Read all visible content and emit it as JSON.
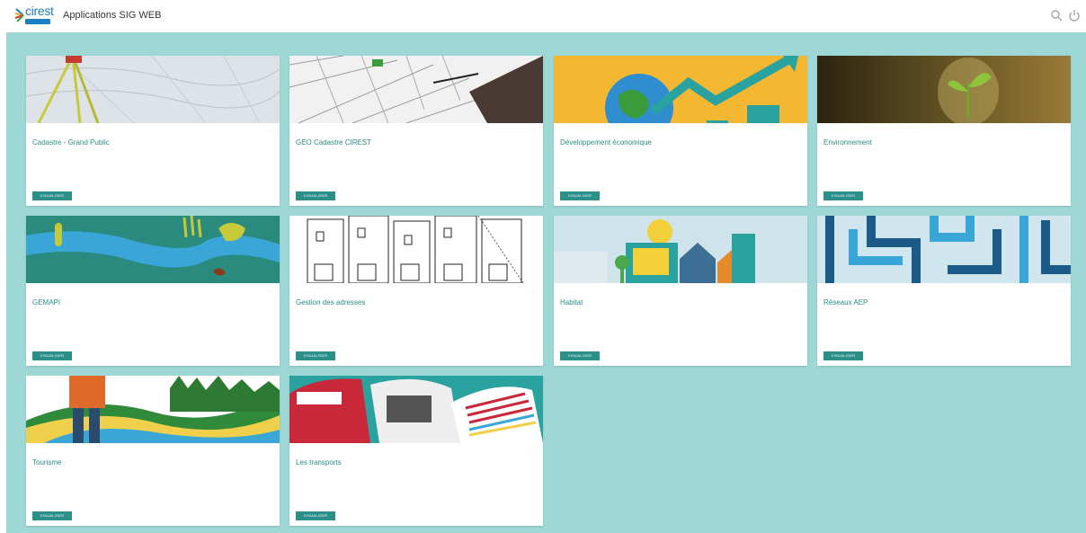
{
  "header": {
    "logo_text": "cirest",
    "title": "Applications SIG WEB",
    "icons": [
      "search-icon",
      "power-icon"
    ]
  },
  "colors": {
    "background": "#9ed8d6",
    "accent": "#2b8f8a",
    "title_text": "#2a8a88"
  },
  "cards": [
    {
      "title": "Cadastre - Grand Public",
      "button": "VISUALISER",
      "image": "cadastre-survey-image"
    },
    {
      "title": "GEO Cadastre CIREST",
      "button": "VISUALISER",
      "image": "cadastre-map-drawing-image"
    },
    {
      "title": "Développement économique",
      "button": "VISUALISER",
      "image": "economic-growth-image"
    },
    {
      "title": "Environnement",
      "button": "VISUALISER",
      "image": "lightbulb-plant-image"
    },
    {
      "title": "GEMAPI",
      "button": "VISUALISER",
      "image": "river-illustration-image"
    },
    {
      "title": "Gestion des adresses",
      "button": "VISUALISER",
      "image": "building-sketch-image"
    },
    {
      "title": "Habitat",
      "button": "VISUALISER",
      "image": "houses-illustration-image"
    },
    {
      "title": "Réseaux AEP",
      "button": "VISUALISER",
      "image": "water-pipes-image"
    },
    {
      "title": "Tourisme",
      "button": "VISUALISER",
      "image": "hiker-landscape-image"
    },
    {
      "title": "Les transports",
      "button": "VISUALISER",
      "image": "trains-illustration-image"
    }
  ]
}
